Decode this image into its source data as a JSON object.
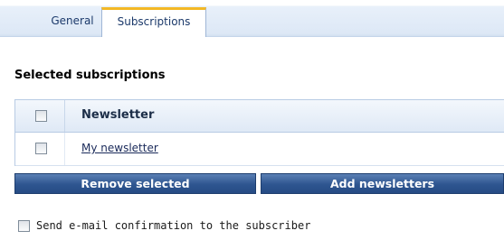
{
  "tabs": [
    {
      "label": "General",
      "active": false
    },
    {
      "label": "Subscriptions",
      "active": true
    }
  ],
  "section": {
    "heading": "Selected subscriptions"
  },
  "table": {
    "column_header": "Newsletter",
    "rows": [
      {
        "name": "My newsletter",
        "checked": false
      }
    ]
  },
  "buttons": {
    "remove_label": "Remove selected",
    "add_label": "Add newsletters"
  },
  "confirmation": {
    "label": "Send e-mail confirmation to the subscriber",
    "checked": false
  },
  "colors": {
    "tab_accent": "#f3b825",
    "button_bg": "#2e5590",
    "header_bg": "#dfe9f6"
  }
}
